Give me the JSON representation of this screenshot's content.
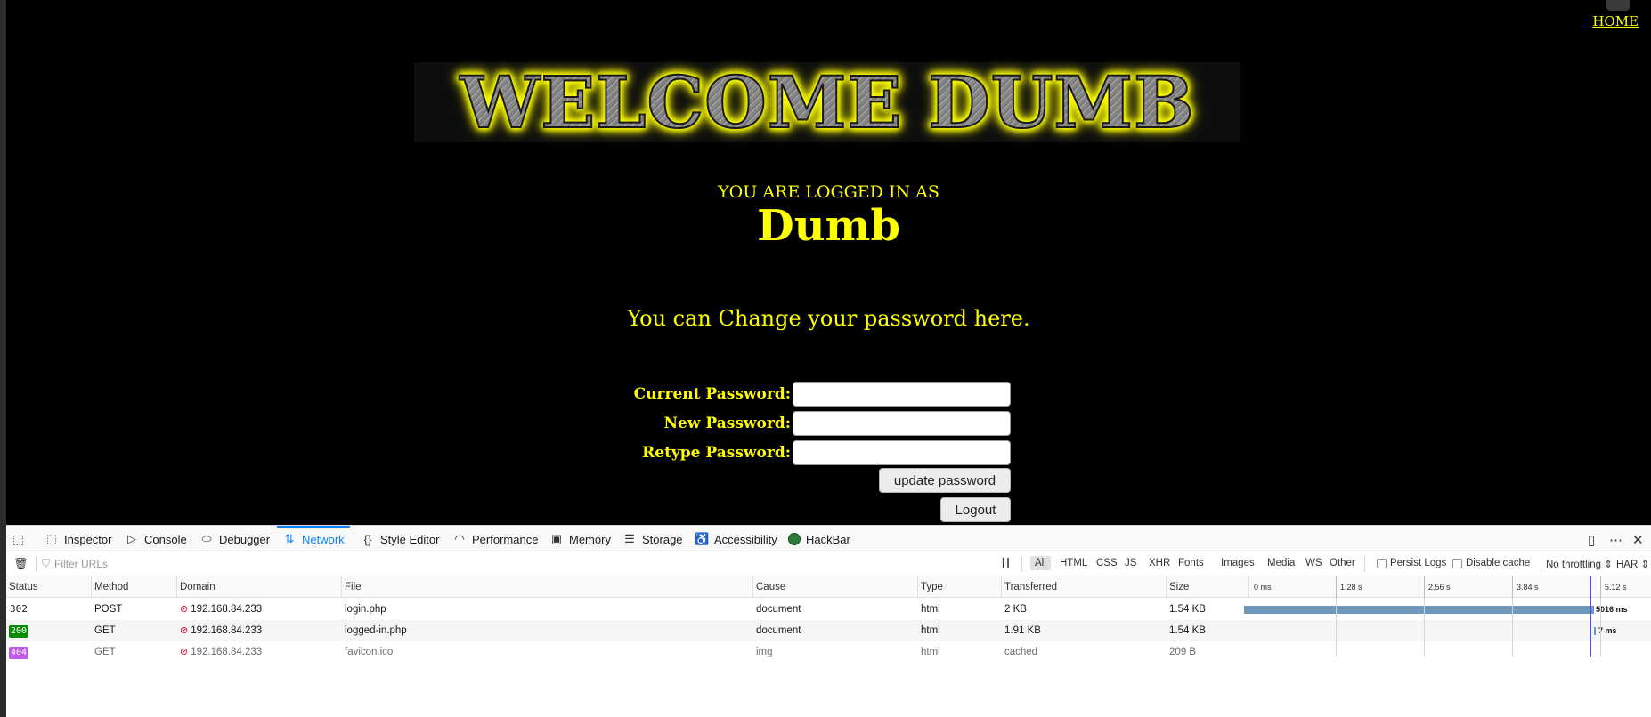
{
  "page": {
    "home_link": "HOME",
    "banner_text": "WELCOME DUMB",
    "logged_in_label": "YOU ARE LOGGED IN AS",
    "username": "Dumb",
    "change_password_text": "You can Change your password here.",
    "form": {
      "current_label": "Current Password:",
      "current_value": "",
      "new_label": "New Password:",
      "new_value": "",
      "retype_label": "Retype Password:",
      "retype_value": "",
      "update_button": "update password",
      "logout_button": "Logout"
    }
  },
  "devtools": {
    "tabs": [
      {
        "label": "Inspector",
        "icon": "inspector-icon"
      },
      {
        "label": "Console",
        "icon": "console-icon"
      },
      {
        "label": "Debugger",
        "icon": "debugger-icon"
      },
      {
        "label": "Network",
        "icon": "network-icon",
        "active": true
      },
      {
        "label": "Style Editor",
        "icon": "style-editor-icon"
      },
      {
        "label": "Performance",
        "icon": "performance-icon"
      },
      {
        "label": "Memory",
        "icon": "memory-icon"
      },
      {
        "label": "Storage",
        "icon": "storage-icon"
      },
      {
        "label": "Accessibility",
        "icon": "accessibility-icon"
      },
      {
        "label": "HackBar",
        "icon": "hackbar-icon"
      }
    ],
    "filter_placeholder": "Filter URLs",
    "filter_types": [
      "All",
      "HTML",
      "CSS",
      "JS",
      "XHR",
      "Fonts",
      "Images",
      "Media",
      "WS",
      "Other"
    ],
    "active_filter": "All",
    "persist_logs": "Persist Logs",
    "disable_cache": "Disable cache",
    "throttling": "No throttling ⇕",
    "har": "HAR ⇕",
    "columns": [
      "Status",
      "Method",
      "Domain",
      "File",
      "Cause",
      "Type",
      "Transferred",
      "Size"
    ],
    "timeline_ticks": [
      "0 ms",
      "1.28 s",
      "2.56 s",
      "3.84 s",
      "5.12 s"
    ],
    "requests": [
      {
        "status": "302",
        "method": "POST",
        "domain": "192.168.84.233",
        "file": "login.php",
        "cause": "document",
        "type": "html",
        "transferred": "2 KB",
        "size": "1.54 KB",
        "timing": "5016 ms",
        "status_color": ""
      },
      {
        "status": "200",
        "method": "GET",
        "domain": "192.168.84.233",
        "file": "logged-in.php",
        "cause": "document",
        "type": "html",
        "transferred": "1.91 KB",
        "size": "1.54 KB",
        "timing": "7 ms",
        "status_color": "#058b00"
      },
      {
        "status": "404",
        "method": "GET",
        "domain": "192.168.84.233",
        "file": "favicon.ico",
        "cause": "img",
        "type": "html",
        "transferred": "cached",
        "size": "209 B",
        "timing": "",
        "status_color": "#c158e8"
      }
    ]
  }
}
